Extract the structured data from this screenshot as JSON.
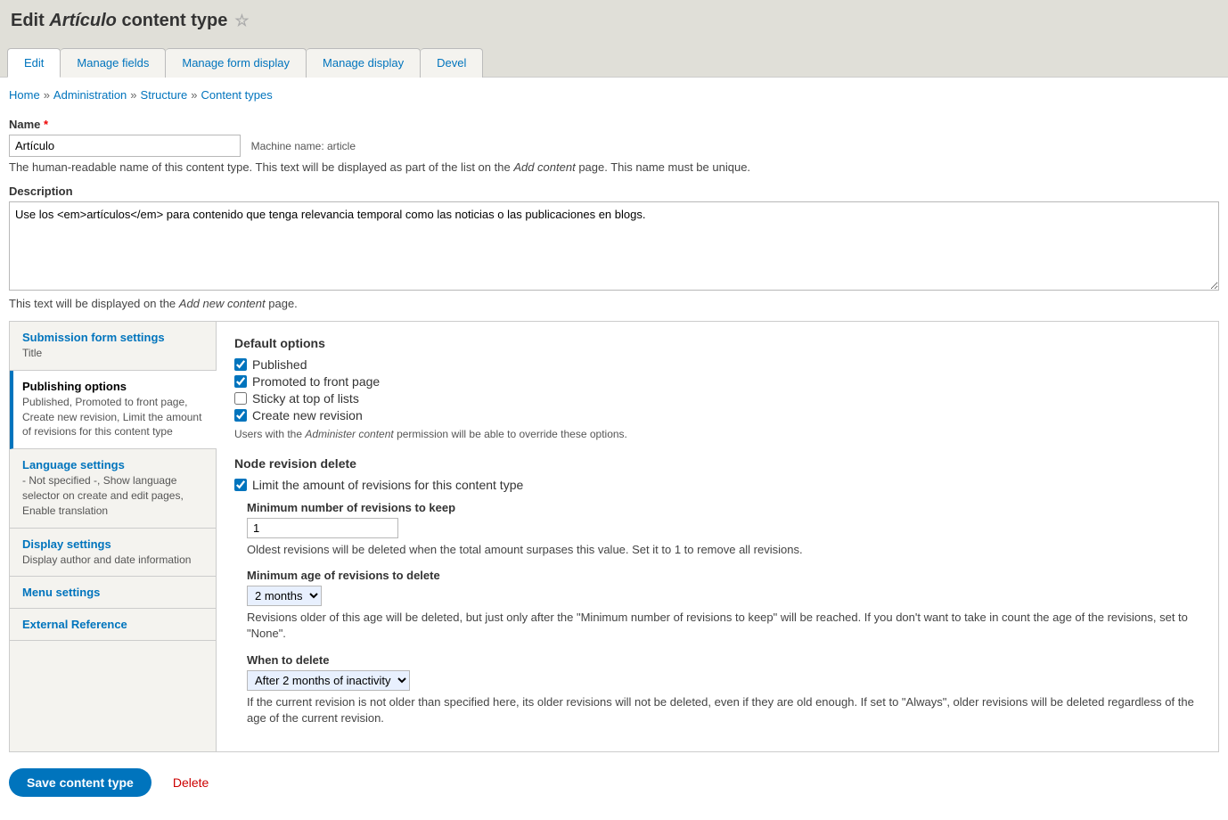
{
  "page": {
    "title_prefix": "Edit",
    "title_em": "Artículo",
    "title_suffix": "content type"
  },
  "tabs": [
    {
      "label": "Edit",
      "active": true
    },
    {
      "label": "Manage fields",
      "active": false
    },
    {
      "label": "Manage form display",
      "active": false
    },
    {
      "label": "Manage display",
      "active": false
    },
    {
      "label": "Devel",
      "active": false
    }
  ],
  "breadcrumb": [
    {
      "label": "Home"
    },
    {
      "label": "Administration"
    },
    {
      "label": "Structure"
    },
    {
      "label": "Content types"
    }
  ],
  "breadcrumb_sep": "»",
  "name_field": {
    "label": "Name",
    "value": "Artículo",
    "machine_name_label": "Machine name: article",
    "description_pre": "The human-readable name of this content type. This text will be displayed as part of the list on the ",
    "description_em": "Add content",
    "description_post": " page. This name must be unique."
  },
  "desc_field": {
    "label": "Description",
    "value": "Use los <em>artículos</em> para contenido que tenga relevancia temporal como las noticias o las publicaciones en blogs.",
    "help_pre": "This text will be displayed on the ",
    "help_em": "Add new content",
    "help_post": " page."
  },
  "vtabs": [
    {
      "title": "Submission form settings",
      "summary": "Title"
    },
    {
      "title": "Publishing options",
      "summary": "Published, Promoted to front page, Create new revision, Limit the amount of revisions for this content type",
      "active": true
    },
    {
      "title": "Language settings",
      "summary": "- Not specified -, Show language selector on create and edit pages, Enable translation"
    },
    {
      "title": "Display settings",
      "summary": "Display author and date information"
    },
    {
      "title": "Menu settings",
      "summary": ""
    },
    {
      "title": "External Reference",
      "summary": ""
    }
  ],
  "publishing": {
    "default_options_label": "Default options",
    "opts": [
      {
        "label": "Published",
        "checked": true
      },
      {
        "label": "Promoted to front page",
        "checked": true
      },
      {
        "label": "Sticky at top of lists",
        "checked": false
      },
      {
        "label": "Create new revision",
        "checked": true
      }
    ],
    "help_pre": "Users with the ",
    "help_em": "Administer content",
    "help_post": " permission will be able to override these options."
  },
  "revision_delete": {
    "legend": "Node revision delete",
    "limit_checkbox": {
      "label": "Limit the amount of revisions for this content type",
      "checked": true
    },
    "min_keep": {
      "label": "Minimum number of revisions to keep",
      "value": "1",
      "desc": "Oldest revisions will be deleted when the total amount surpases this value. Set it to 1 to remove all revisions."
    },
    "min_age": {
      "label": "Minimum age of revisions to delete",
      "value": "2 months",
      "desc": "Revisions older of this age will be deleted, but just only after the \"Minimum number of revisions to keep\" will be reached. If you don't want to take in count the age of the revisions, set to \"None\"."
    },
    "when_delete": {
      "label": "When to delete",
      "value": "After 2 months of inactivity",
      "desc": "If the current revision is not older than specified here, its older revisions will not be deleted, even if they are old enough. If set to \"Always\", older revisions will be deleted regardless of the age of the current revision."
    }
  },
  "actions": {
    "save": "Save content type",
    "delete": "Delete"
  }
}
